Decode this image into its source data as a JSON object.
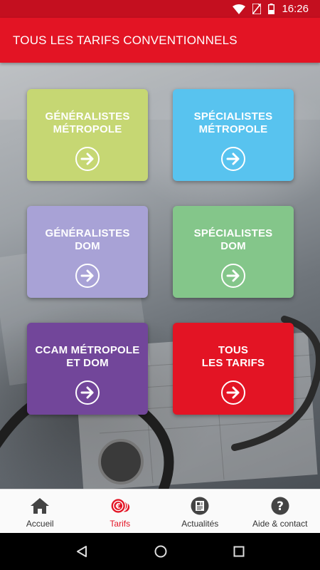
{
  "status_bar": {
    "time": "16:26"
  },
  "app_bar": {
    "title": "TOUS LES TARIFS CONVENTIONNELS"
  },
  "tiles": [
    {
      "line1": "GÉNÉRALISTES",
      "line2": "MÉTROPOLE",
      "color": "#c6d773"
    },
    {
      "line1": "SPÉCIALISTES",
      "line2": "MÉTROPOLE",
      "color": "#58c3ef"
    },
    {
      "line1": "GÉNÉRALISTES",
      "line2": "DOM",
      "color": "#a8a2d6"
    },
    {
      "line1": "SPÉCIALISTES",
      "line2": "DOM",
      "color": "#84c68a"
    },
    {
      "line1": "CCAM MÉTROPOLE",
      "line2": "ET DOM",
      "color": "#72469a"
    },
    {
      "line1": "TOUS",
      "line2": "LES TARIFS",
      "color": "#e31424"
    }
  ],
  "bottom_nav": {
    "items": [
      {
        "label": "Accueil",
        "icon": "home-icon"
      },
      {
        "label": "Tarifs",
        "icon": "euro-coins-icon",
        "active": true
      },
      {
        "label": "Actualités",
        "icon": "newspaper-icon"
      },
      {
        "label": "Aide & contact",
        "icon": "help-icon"
      }
    ]
  },
  "colors": {
    "accent": "#e31424",
    "status_bar": "#c40f1f"
  }
}
